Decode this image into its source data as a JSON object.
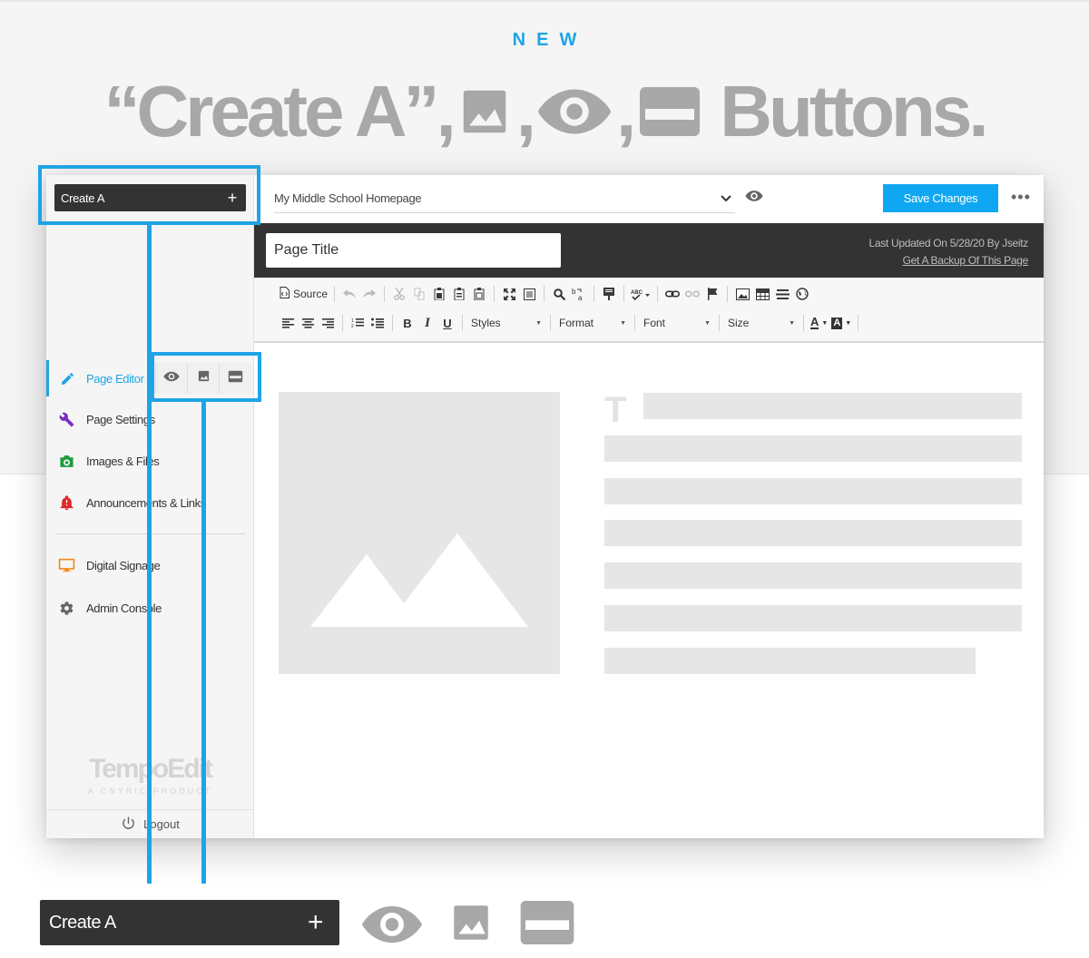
{
  "hero": {
    "kicker": "NEW",
    "headline_prefix": "“Create A”,",
    "headline_suffix": "Buttons."
  },
  "sidebar": {
    "create_label": "Create A",
    "create_plus": "+",
    "items": [
      {
        "label": "Page Editor",
        "icon": "pencil-icon",
        "active": true
      },
      {
        "label": "Page Settings",
        "icon": "wrench-icon"
      },
      {
        "label": "Images & Files",
        "icon": "camera-icon"
      },
      {
        "label": "Announcements & Links",
        "icon": "bell-alert-icon"
      },
      {
        "label": "Digital Signage",
        "icon": "monitor-icon"
      },
      {
        "label": "Admin Console",
        "icon": "gear-icon"
      }
    ],
    "mini_buttons": [
      "eye-icon",
      "image-icon",
      "banner-icon"
    ],
    "brand_name": "TempoEdit",
    "brand_sub": "A CNYRIC PRODUCT",
    "logout_label": "Logout"
  },
  "topbar": {
    "page_select": "My Middle School Homepage",
    "save_label": "Save Changes",
    "more_label": "•••"
  },
  "titlebar": {
    "title_value": "Page Title",
    "updated_text": "Last Updated On 5/28/20 By Jseitz",
    "backup_link": "Get A Backup Of This Page"
  },
  "toolbar": {
    "source_label": "Source",
    "styles_label": "Styles",
    "format_label": "Format",
    "font_label": "Font",
    "size_label": "Size",
    "bold": "B",
    "italic": "I",
    "underline": "U",
    "text_color": "A",
    "bg_color": "A"
  },
  "canvas": {
    "placeholder_letter": "T"
  },
  "bottom": {
    "create_label": "Create A",
    "create_plus": "+"
  },
  "colors": {
    "accent": "#1ea4e6",
    "save": "#10a7f2",
    "dark": "#333333",
    "headline": "#a8a8a8"
  }
}
